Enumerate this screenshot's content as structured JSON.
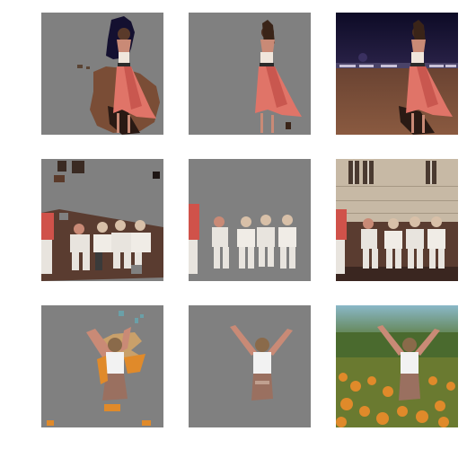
{
  "grid": {
    "rows": [
      {
        "name": "woman-in-pink-dress",
        "panels": [
          {
            "kind": "rough-mask",
            "caption": ""
          },
          {
            "kind": "refined-mask",
            "caption": ""
          },
          {
            "kind": "original",
            "caption": ""
          }
        ]
      },
      {
        "name": "seated-group",
        "panels": [
          {
            "kind": "rough-mask",
            "caption": ""
          },
          {
            "kind": "refined-mask",
            "caption": ""
          },
          {
            "kind": "original",
            "caption": ""
          }
        ]
      },
      {
        "name": "child-in-flower-field",
        "panels": [
          {
            "kind": "rough-mask",
            "caption": ""
          },
          {
            "kind": "refined-mask",
            "caption": ""
          },
          {
            "kind": "original",
            "caption": ""
          }
        ]
      }
    ]
  },
  "colors": {
    "mask_gray": "#808080",
    "background": "#ffffff",
    "dress": "#e07468",
    "beach_sand": "#7a4d36",
    "night_sky": "#120f2a",
    "wall": "#c7b9a5",
    "flowers": "#e08a2a",
    "grass": "#5b7a3a",
    "shirt": "#f2f2f2"
  }
}
